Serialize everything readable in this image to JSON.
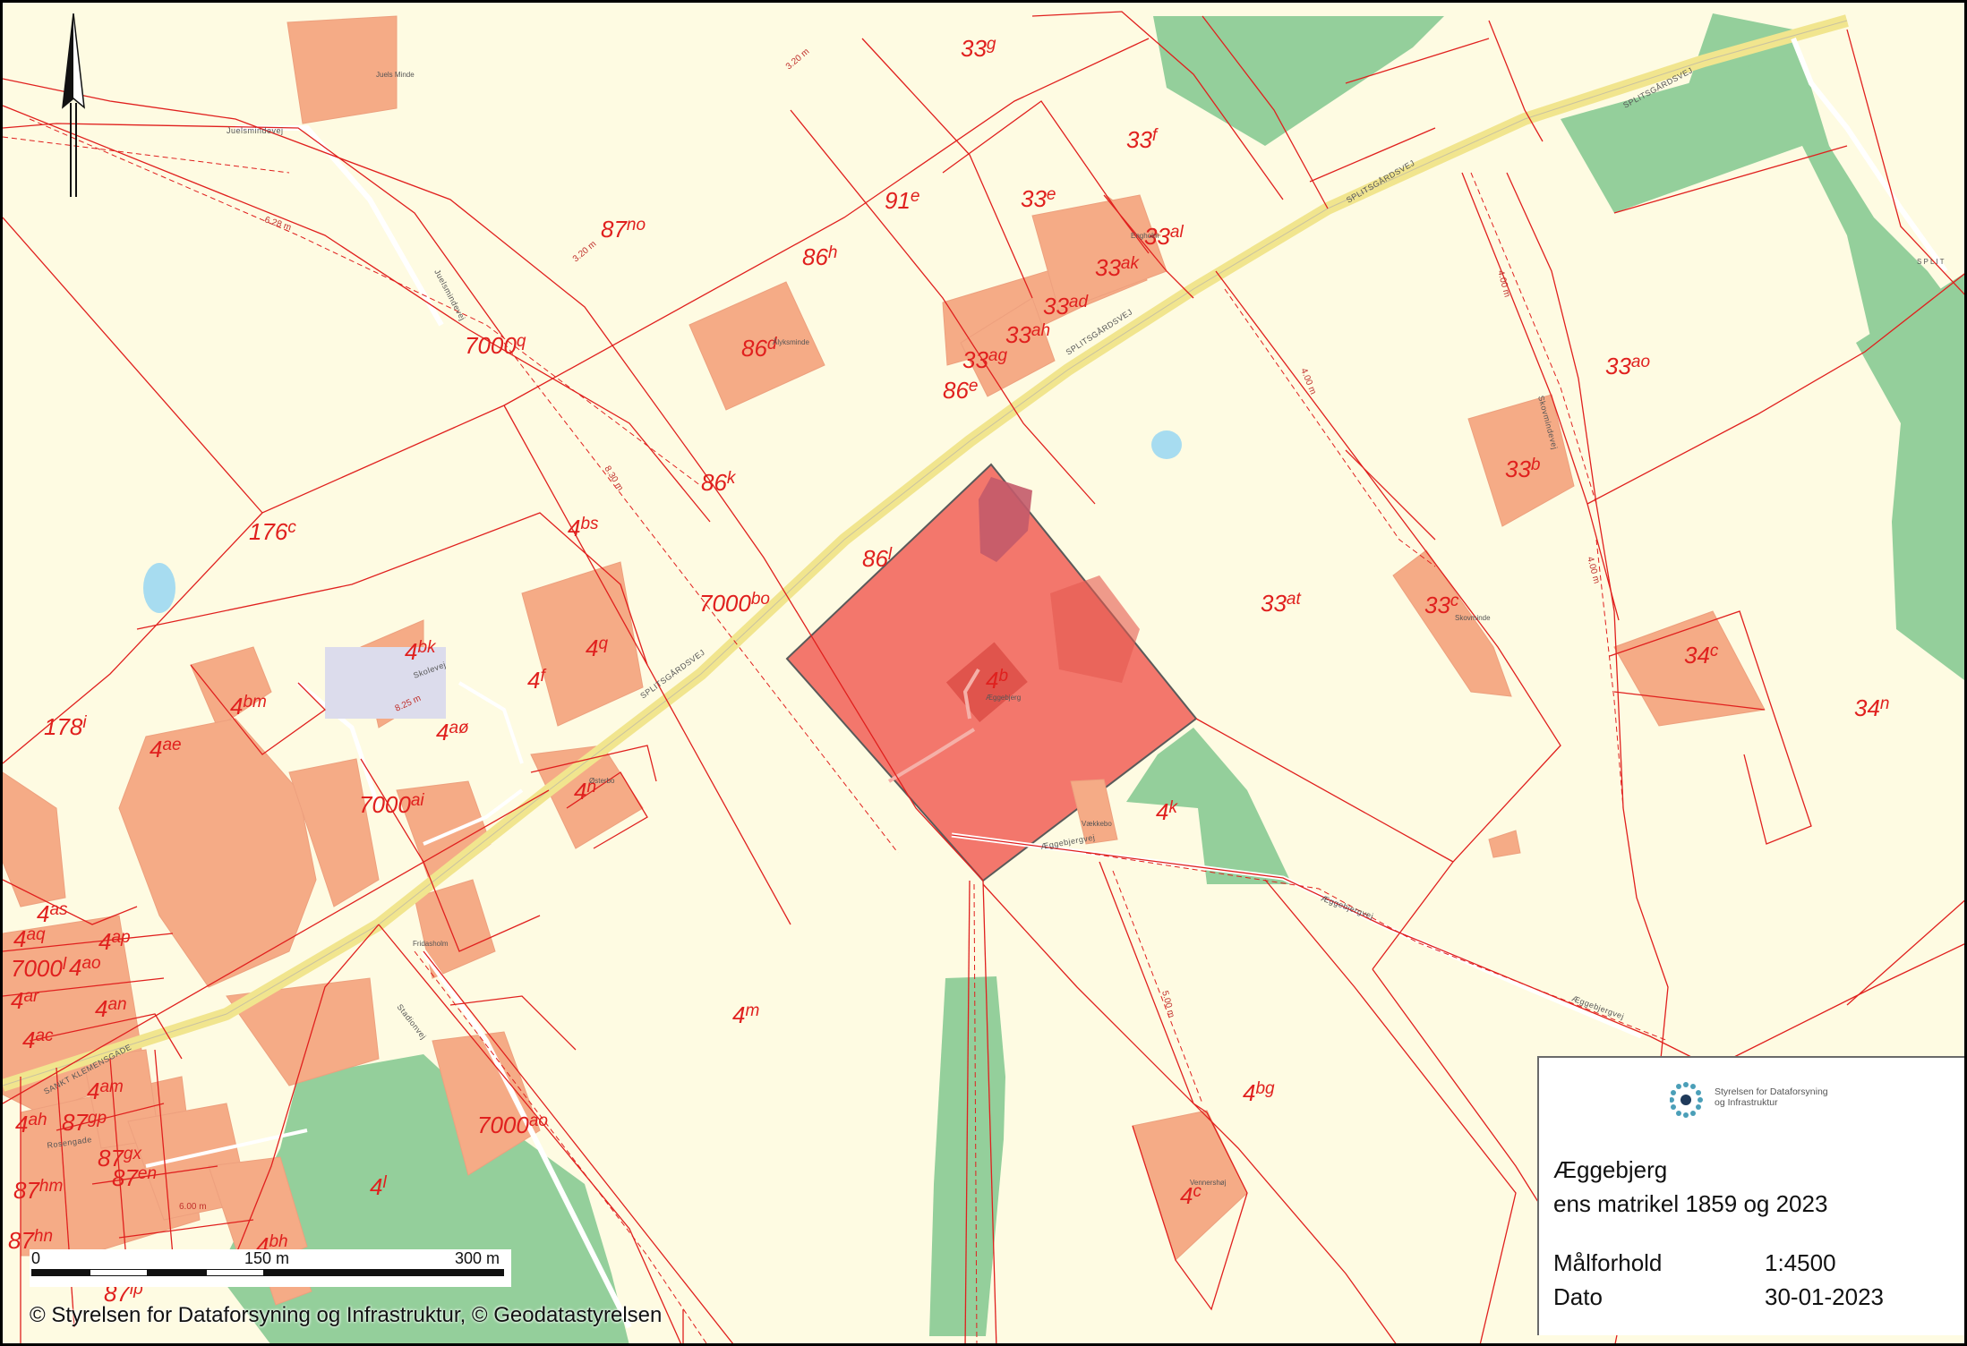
{
  "map": {
    "parcels": [
      {
        "num": "33",
        "suf": "g"
      },
      {
        "num": "33",
        "suf": "f"
      },
      {
        "num": "91",
        "suf": "e"
      },
      {
        "num": "33",
        "suf": "e"
      },
      {
        "num": "87",
        "suf": "no"
      },
      {
        "num": "86",
        "suf": "h"
      },
      {
        "num": "33",
        "suf": "al"
      },
      {
        "num": "33",
        "suf": "ak"
      },
      {
        "num": "33",
        "suf": "ad"
      },
      {
        "num": "33",
        "suf": "ah"
      },
      {
        "num": "33",
        "suf": "ag"
      },
      {
        "num": "86",
        "suf": "e"
      },
      {
        "num": "86",
        "suf": "d"
      },
      {
        "num": "7000",
        "suf": "q"
      },
      {
        "num": "33",
        "suf": "ao"
      },
      {
        "num": "33",
        "suf": "b"
      },
      {
        "num": "86",
        "suf": "k"
      },
      {
        "num": "176",
        "suf": "c"
      },
      {
        "num": "4",
        "suf": "bs"
      },
      {
        "num": "86",
        "suf": "l"
      },
      {
        "num": "33",
        "suf": "at"
      },
      {
        "num": "33",
        "suf": "c"
      },
      {
        "num": "7000",
        "suf": "bo"
      },
      {
        "num": "4",
        "suf": "bk"
      },
      {
        "num": "4",
        "suf": "q"
      },
      {
        "num": "4",
        "suf": "b"
      },
      {
        "num": "34",
        "suf": "c"
      },
      {
        "num": "4",
        "suf": "f"
      },
      {
        "num": "4",
        "suf": "bm"
      },
      {
        "num": "178",
        "suf": "i"
      },
      {
        "num": "4",
        "suf": "aø"
      },
      {
        "num": "4",
        "suf": "ae"
      },
      {
        "num": "34",
        "suf": "n"
      },
      {
        "num": "7000",
        "suf": "ai"
      },
      {
        "num": "4",
        "suf": "n"
      },
      {
        "num": "4",
        "suf": "k"
      },
      {
        "num": "4",
        "suf": "as"
      },
      {
        "num": "4",
        "suf": "aq"
      },
      {
        "num": "4",
        "suf": "ap"
      },
      {
        "num": "7000",
        "suf": "l"
      },
      {
        "num": "4",
        "suf": "ao"
      },
      {
        "num": "4",
        "suf": "ar"
      },
      {
        "num": "4",
        "suf": "an"
      },
      {
        "num": "4",
        "suf": "m"
      },
      {
        "num": "4",
        "suf": "ac"
      },
      {
        "num": "4",
        "suf": "am"
      },
      {
        "num": "4",
        "suf": "bg"
      },
      {
        "num": "4",
        "suf": "ah"
      },
      {
        "num": "87",
        "suf": "gp"
      },
      {
        "num": "7000",
        "suf": "ao"
      },
      {
        "num": "87",
        "suf": "gx"
      },
      {
        "num": "87",
        "suf": "hm"
      },
      {
        "num": "87",
        "suf": "en"
      },
      {
        "num": "4",
        "suf": "l"
      },
      {
        "num": "4",
        "suf": "c"
      },
      {
        "num": "87",
        "suf": "hn"
      },
      {
        "num": "4",
        "suf": "bh"
      },
      {
        "num": "87",
        "suf": "lp"
      }
    ],
    "roads": [
      "Juelsmindevej",
      "Juelsmindevej",
      "SPLITSGÅRDSVEJ",
      "SPLITSGÅRDSVEJ",
      "SPLITSGÅRDSVEJ",
      "SPLITSGÅRDSVEJ",
      "SANKT KLEMENSGADE",
      "Skolevej",
      "Stadionvej",
      "Æggebjergvej",
      "Æggebjergvej",
      "Æggebjergvej",
      "Rosengade",
      "Juelsmindevej",
      "Skovmindevej"
    ],
    "places": [
      "Juels Minde",
      "Engholm",
      "Ålyksminde",
      "Æggebjerg",
      "Skovminde",
      "Østerbo",
      "Vækkebo",
      "Fridasholm",
      "Vennershøj",
      "S P L I T"
    ],
    "dims": [
      "3.20 m",
      "3.20 m",
      "6.28 m",
      "8.30 m",
      "8.25 m",
      "4.00 m",
      "4.00 m",
      "4.00 m",
      "5.00 m",
      "6.00 m"
    ],
    "highlight_color": "#f26b62",
    "parcel_line_color": "#e0201e"
  },
  "info": {
    "agency": "Styrelsen for Dataforsyning og Infrastruktur",
    "title": "Æggebjerg",
    "subtitle": "ens matrikel 1859 og 2023",
    "scale_label": "Målforhold",
    "scale_value": "1:4500",
    "date_label": "Dato",
    "date_value": "30-01-2023"
  },
  "scalebar": {
    "labels": [
      "0",
      "150 m",
      "300 m"
    ]
  },
  "copyright": "© Styrelsen for Dataforsyning og Infrastruktur, © Geodatastyrelsen",
  "north_arrow": "north-arrow-icon"
}
